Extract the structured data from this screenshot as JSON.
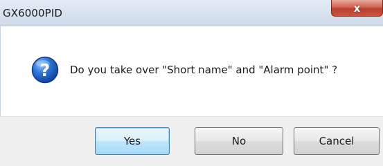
{
  "window": {
    "title": "GX6000PID",
    "close_icon": "close-icon",
    "close_glyph": "x"
  },
  "dialog": {
    "icon": "question-icon",
    "message": "Do you take over \"Short name\" and \"Alarm point\" ?"
  },
  "buttons": {
    "yes_label": "Yes",
    "no_label": "No",
    "cancel_label": "Cancel"
  },
  "colors": {
    "close_button": "#c9543f",
    "icon_blue": "#1f5fbf",
    "default_button_border": "#3c7fb1"
  }
}
